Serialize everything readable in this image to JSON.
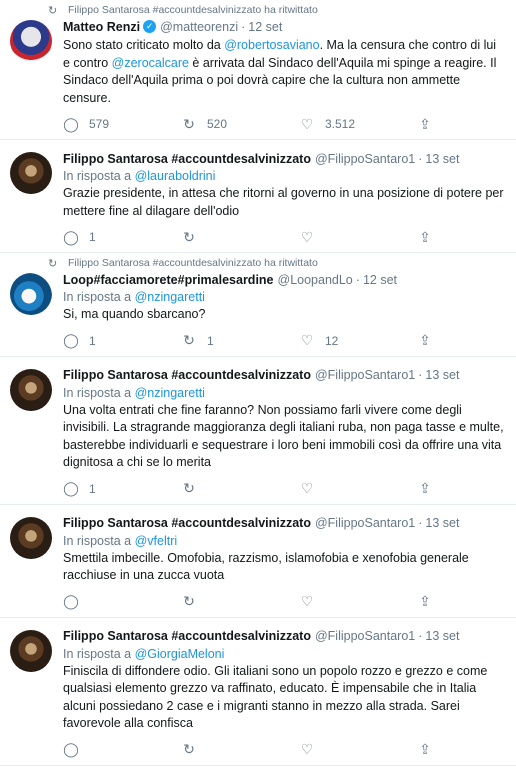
{
  "tweets": [
    {
      "retweet_by": "Filippo Santarosa #accountdesalvinizzato ha ritwittato",
      "avatar": "renzi",
      "name": "Matteo Renzi",
      "verified": true,
      "handle": "@matteorenzi",
      "date": "12 set",
      "reply_prefix": "",
      "reply_to": "",
      "text_parts": [
        {
          "t": "Sono stato criticato molto da "
        },
        {
          "t": "@robertosaviano",
          "m": true
        },
        {
          "t": ". Ma la censura che contro di lui e contro "
        },
        {
          "t": "@zerocalcare",
          "m": true
        },
        {
          "t": " è arrivata dal Sindaco dell'Aquila mi spinge a reagire. Il Sindaco dell'Aquila prima o poi dovrà capire che la cultura non ammette censure."
        }
      ],
      "replies": "579",
      "retweets": "520",
      "likes": "3.512"
    },
    {
      "retweet_by": "",
      "avatar": "fs",
      "name": "Filippo Santarosa #accountdesalvinizzato",
      "verified": false,
      "handle": "@FilippoSantaro1",
      "date": "13 set",
      "reply_prefix": "In risposta a",
      "reply_to": "@lauraboldrini",
      "text_parts": [
        {
          "t": "Grazie presidente, in attesa che ritorni al governo in una posizione di potere per mettere fine al dilagare dell'odio"
        }
      ],
      "replies": "1",
      "retweets": "",
      "likes": ""
    },
    {
      "retweet_by": "Filippo Santarosa #accountdesalvinizzato ha ritwittato",
      "avatar": "loop",
      "name": "Loop#facciamorete#primalesardine",
      "verified": false,
      "handle": "@LoopandLo",
      "date": "12 set",
      "reply_prefix": "In risposta a",
      "reply_to": "@nzingaretti",
      "text_parts": [
        {
          "t": "Si, ma quando sbarcano?"
        }
      ],
      "replies": "1",
      "retweets": "1",
      "likes": "12"
    },
    {
      "retweet_by": "",
      "avatar": "fs",
      "name": "Filippo Santarosa #accountdesalvinizzato",
      "verified": false,
      "handle": "@FilippoSantaro1",
      "date": "13 set",
      "reply_prefix": "In risposta a",
      "reply_to": "@nzingaretti",
      "text_parts": [
        {
          "t": "Una volta entrati che fine faranno? Non possiamo farli vivere come degli invisibili. La stragrande maggioranza degli italiani ruba, non paga tasse e multe, basterebbe individuarli e sequestrare i loro beni immobili così da offrire una vita dignitosa a chi se lo merita"
        }
      ],
      "replies": "1",
      "retweets": "",
      "likes": ""
    },
    {
      "retweet_by": "",
      "avatar": "fs",
      "name": "Filippo Santarosa #accountdesalvinizzato",
      "verified": false,
      "handle": "@FilippoSantaro1",
      "date": "13 set",
      "reply_prefix": "In risposta a",
      "reply_to": "@vfeltri",
      "text_parts": [
        {
          "t": "Smettila imbecille. Omofobia, razzismo, islamofobia e xenofobia generale racchiuse in una zucca vuota"
        }
      ],
      "replies": "",
      "retweets": "",
      "likes": ""
    },
    {
      "retweet_by": "",
      "avatar": "fs",
      "name": "Filippo Santarosa #accountdesalvinizzato",
      "verified": false,
      "handle": "@FilippoSantaro1",
      "date": "13 set",
      "reply_prefix": "In risposta a",
      "reply_to": "@GiorgiaMeloni",
      "text_parts": [
        {
          "t": "Finiscila di diffondere odio. Gli italiani sono un popolo rozzo e grezzo e come qualsiasi elemento grezzo va raffinato, educato. È impensabile che in Italia alcuni possiedano 2 case e i migranti stanno in mezzo alla strada. Sarei favorevole alla confisca"
        }
      ],
      "replies": "",
      "retweets": "",
      "likes": ""
    }
  ],
  "icons": {
    "retweet": "retweet-icon",
    "reply": "reply-icon",
    "like": "heart-icon",
    "share": "share-icon",
    "verified": "verified-badge-icon"
  },
  "colors": {
    "link": "#1b95e0",
    "muted": "#657786",
    "text": "#14171a",
    "divider": "#e6ecf0"
  }
}
